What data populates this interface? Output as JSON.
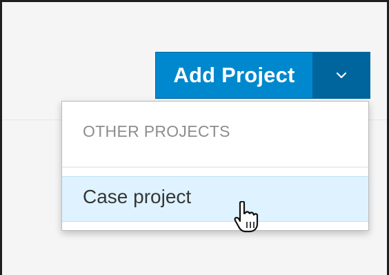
{
  "toolbar": {
    "add_project_label": "Add Project",
    "toggle_icon": "chevron-down-icon"
  },
  "dropdown": {
    "header": "OTHER PROJECTS",
    "items": [
      {
        "label": "Case project",
        "state": "hovered"
      }
    ]
  },
  "colors": {
    "primary": "#0088ce",
    "primary_dark": "#00659c",
    "menu_hover": "#def3ff",
    "header_text": "#8b8d8f"
  },
  "cursor": "hand-pointer-icon"
}
